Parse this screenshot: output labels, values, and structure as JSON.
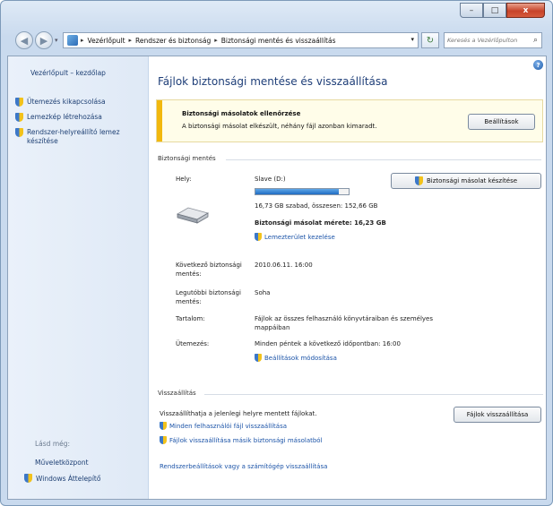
{
  "window": {
    "buttons": {
      "minimize": "–",
      "maximize": "□",
      "close": "x"
    }
  },
  "nav": {
    "breadcrumbs": [
      "Vezérlőpult",
      "Rendszer és biztonság",
      "Biztonsági mentés és visszaállítás"
    ],
    "search_placeholder": "Keresés a Vezérlőpulton",
    "icons": {
      "back": "arrow-left-icon",
      "forward": "arrow-right-icon",
      "refresh": "refresh-icon",
      "search": "search-icon"
    }
  },
  "sidebar": {
    "home": "Vezérlőpult – kezdőlap",
    "tasks": [
      "Ütemezés kikapcsolása",
      "Lemezkép létrehozása",
      "Rendszer-helyreállító lemez készítése"
    ],
    "see_also_label": "Lásd még:",
    "see_also": [
      "Műveletközpont",
      "Windows Áttelepítő"
    ]
  },
  "main": {
    "title": "Fájlok biztonsági mentése és visszaállítása",
    "notice": {
      "title": "Biztonsági másolatok ellenőrzése",
      "text": "A biztonsági másolat elkészült, néhány fájl azonban kimaradt.",
      "button": "Beállítások",
      "accent_color": "#f2b80e"
    },
    "backup": {
      "header": "Biztonsági mentés",
      "location_label": "Hely:",
      "drive_name": "Slave (D:)",
      "drive_fill_fraction": 0.89,
      "free_space": "16,73 GB szabad, összesen: 152,66 GB",
      "backup_size": "Biztonsági másolat mérete: 16,23 GB",
      "manage_space_link": "Lemezterület kezelése",
      "backup_now_button": "Biztonsági másolat készítése",
      "next_backup_label": "Következő biztonsági mentés:",
      "next_backup_value": "2010.06.11. 16:00",
      "last_backup_label": "Legutóbbi biztonsági mentés:",
      "last_backup_value": "Soha",
      "contents_label": "Tartalom:",
      "contents_value": "Fájlok az összes felhasználó könyvtáraiban és személyes mappáiban",
      "schedule_label": "Ütemezés:",
      "schedule_value": "Minden péntek a következő időpontban: 16:00",
      "change_settings_link": "Beállítások módosítása"
    },
    "restore": {
      "header": "Visszaállítás",
      "text": "Visszaállíthatja a jelenlegi helyre mentett fájlokat.",
      "restore_button": "Fájlok visszaállítása",
      "link_all_users": "Minden felhasználói fájl visszaállítása",
      "link_other_backup": "Fájlok visszaállítása másik biztonsági másolatból",
      "link_system": "Rendszerbeállítások vagy a számítógép visszaállítása"
    }
  }
}
